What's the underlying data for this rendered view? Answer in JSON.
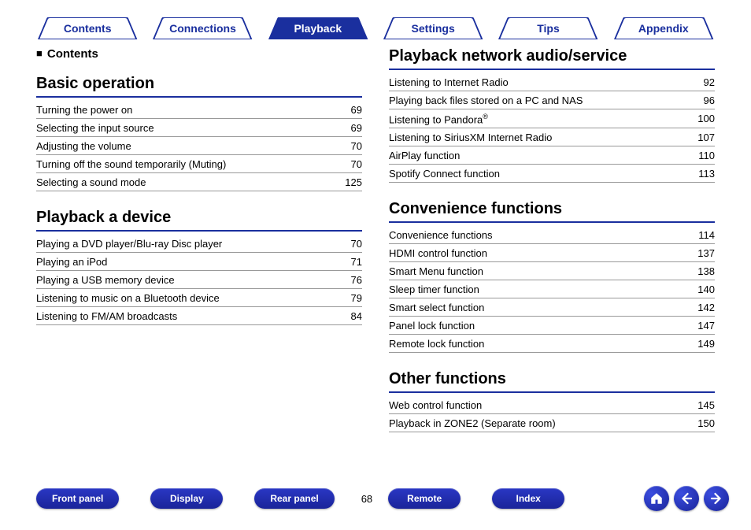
{
  "nav": {
    "tabs": [
      "Contents",
      "Connections",
      "Playback",
      "Settings",
      "Tips",
      "Appendix"
    ],
    "active_index": 2
  },
  "contents_label": "Contents",
  "left_sections": [
    {
      "title": "Basic operation",
      "rows": [
        {
          "label": "Turning the power on",
          "page": "69"
        },
        {
          "label": "Selecting the input source",
          "page": "69"
        },
        {
          "label": "Adjusting the volume",
          "page": "70"
        },
        {
          "label": "Turning off the sound temporarily (Muting)",
          "page": "70"
        },
        {
          "label": "Selecting a sound mode",
          "page": "125"
        }
      ]
    },
    {
      "title": "Playback a device",
      "rows": [
        {
          "label": "Playing a DVD player/Blu-ray Disc player",
          "page": "70"
        },
        {
          "label": "Playing an iPod",
          "page": "71"
        },
        {
          "label": "Playing a USB memory device",
          "page": "76"
        },
        {
          "label": "Listening to music on a Bluetooth device",
          "page": "79"
        },
        {
          "label": "Listening to FM/AM broadcasts",
          "page": "84"
        }
      ]
    }
  ],
  "right_sections": [
    {
      "title": "Playback network audio/service",
      "rows": [
        {
          "label": "Listening to Internet Radio",
          "page": "92"
        },
        {
          "label": "Playing back files stored on a PC and NAS",
          "page": "96"
        },
        {
          "label": "Listening to Pandora",
          "sup": "®",
          "page": "100"
        },
        {
          "label": "Listening to SiriusXM Internet Radio",
          "page": "107"
        },
        {
          "label": "AirPlay function",
          "page": "110"
        },
        {
          "label": "Spotify Connect function",
          "page": "113"
        }
      ]
    },
    {
      "title": "Convenience functions",
      "rows": [
        {
          "label": "Convenience functions",
          "page": "114"
        },
        {
          "label": "HDMI control function",
          "page": "137"
        },
        {
          "label": "Smart Menu function",
          "page": "138"
        },
        {
          "label": "Sleep timer function",
          "page": "140"
        },
        {
          "label": "Smart select function",
          "page": "142"
        },
        {
          "label": "Panel lock function",
          "page": "147"
        },
        {
          "label": "Remote lock function",
          "page": "149"
        }
      ]
    },
    {
      "title": "Other functions",
      "rows": [
        {
          "label": "Web control function",
          "page": "145"
        },
        {
          "label": "Playback in ZONE2 (Separate room)",
          "page": "150"
        }
      ]
    }
  ],
  "bottom": {
    "buttons": [
      "Front panel",
      "Display",
      "Rear panel",
      "Remote",
      "Index"
    ],
    "page_number": "68"
  }
}
